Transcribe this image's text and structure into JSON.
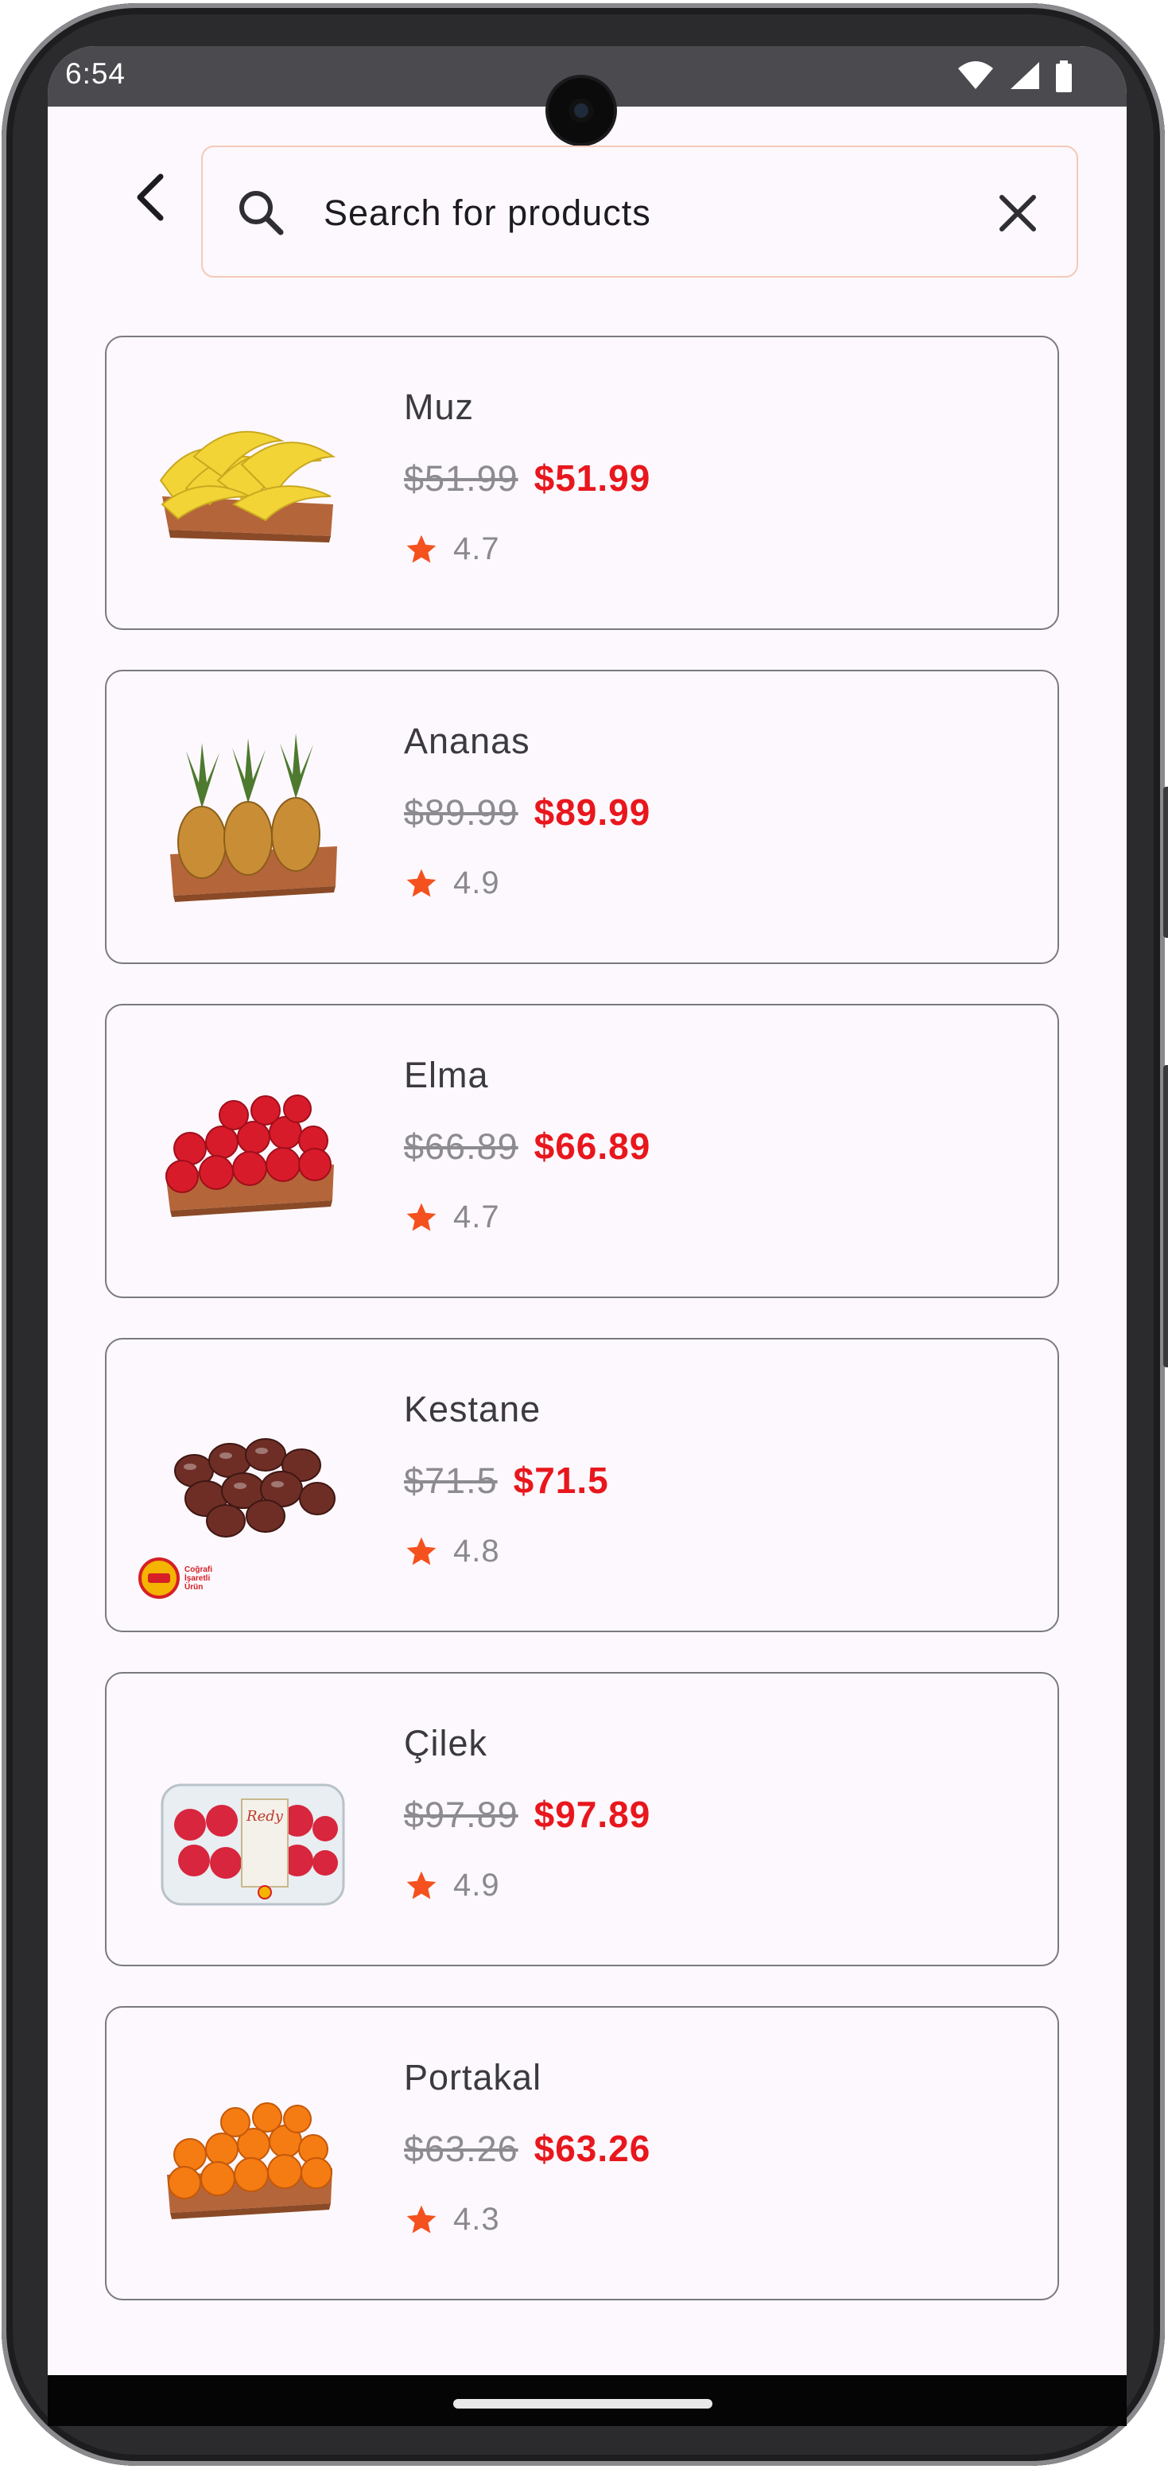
{
  "status_bar": {
    "time": "6:54",
    "icons": [
      "wifi-icon",
      "cellular-signal-icon",
      "battery-icon"
    ]
  },
  "top_bar": {
    "back_icon": "back-arrow-icon",
    "search": {
      "value": "",
      "placeholder": "Search for products",
      "search_icon": "search-icon",
      "clear_icon": "close-icon",
      "border_color": "#f4c9b8"
    }
  },
  "products": [
    {
      "name": "Muz",
      "old_price": "$51.99",
      "price": "$51.99",
      "rating": "4.7",
      "image": "bananas-in-wooden-crate"
    },
    {
      "name": "Ananas",
      "old_price": "$89.99",
      "price": "$89.99",
      "rating": "4.9",
      "image": "pineapples-in-wooden-crate"
    },
    {
      "name": "Elma",
      "old_price": "$66.89",
      "price": "$66.89",
      "rating": "4.7",
      "image": "red-apples-in-wooden-crate"
    },
    {
      "name": "Kestane",
      "old_price": "$71.5",
      "price": "$71.5",
      "rating": "4.8",
      "image": "chestnuts-pile",
      "badge_text": "Coğrafi İşaretli Ürün"
    },
    {
      "name": "Çilek",
      "old_price": "$97.89",
      "price": "$97.89",
      "rating": "4.9",
      "image": "strawberries-in-plastic-box",
      "brand_text": "Redy"
    },
    {
      "name": "Portakal",
      "old_price": "$63.26",
      "price": "$63.26",
      "rating": "4.3",
      "image": "oranges-in-wooden-crate"
    }
  ],
  "colors": {
    "background": "#fdf8fd",
    "sale_price": "#e8171d",
    "star": "#f4511e",
    "card_border": "#7a7a7e",
    "muted_text": "#8c8b90"
  }
}
